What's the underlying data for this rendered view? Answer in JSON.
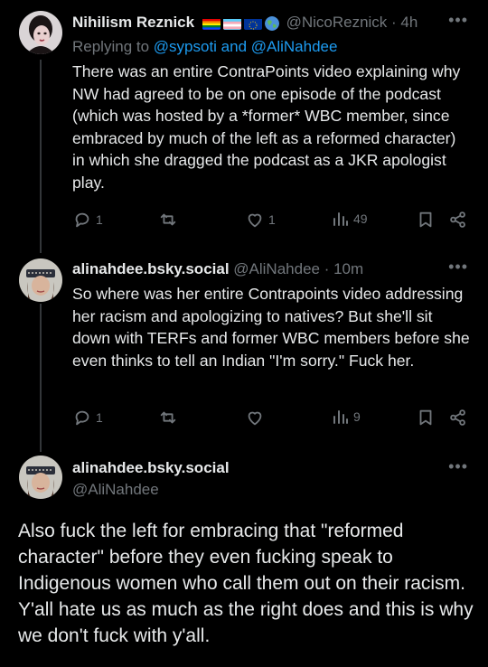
{
  "tweets": [
    {
      "name": "Nihilism Reznick",
      "handle": "@NicoReznick",
      "time": "· 4h",
      "reply_prefix": "Replying to ",
      "reply_targets": "@sypsoti and @AliNahdee",
      "text": "There was an entire ContraPoints video explaining why NW had agreed to be on one episode of the podcast (which was hosted by a *former* WBC member, since embraced by much of the left as a reformed character) in which she dragged the podcast as a JKR apologist play.",
      "replies": "1",
      "retweets": "",
      "likes": "1",
      "views": "49"
    },
    {
      "name": "alinahdee.bsky.social",
      "handle": "@AliNahdee",
      "time": "· 10m",
      "text": "So where was her entire Contrapoints video addressing her racism and apologizing to natives? But she'll sit down with TERFs and former WBC members before she even thinks to tell an Indian \"I'm sorry.\" Fuck her.",
      "replies": "1",
      "retweets": "",
      "likes": "",
      "views": "9"
    },
    {
      "name": "alinahdee.bsky.social",
      "handle": "@AliNahdee",
      "text": "Also fuck the left for embracing that \"reformed character\" before they even fucking speak to Indigenous women who call them out on their racism. Y'all hate us as much as the right does and this is why we don't fuck with y'all."
    }
  ],
  "icons": {
    "more": "more-horizontal-icon",
    "reply": "reply-icon",
    "retweet": "retweet-icon",
    "like": "heart-icon",
    "views": "views-icon",
    "bookmark": "bookmark-icon",
    "share": "share-icon"
  },
  "colors": {
    "background": "#000000",
    "text": "#e7e9ea",
    "muted": "#71767b",
    "link": "#1d9bf0"
  }
}
